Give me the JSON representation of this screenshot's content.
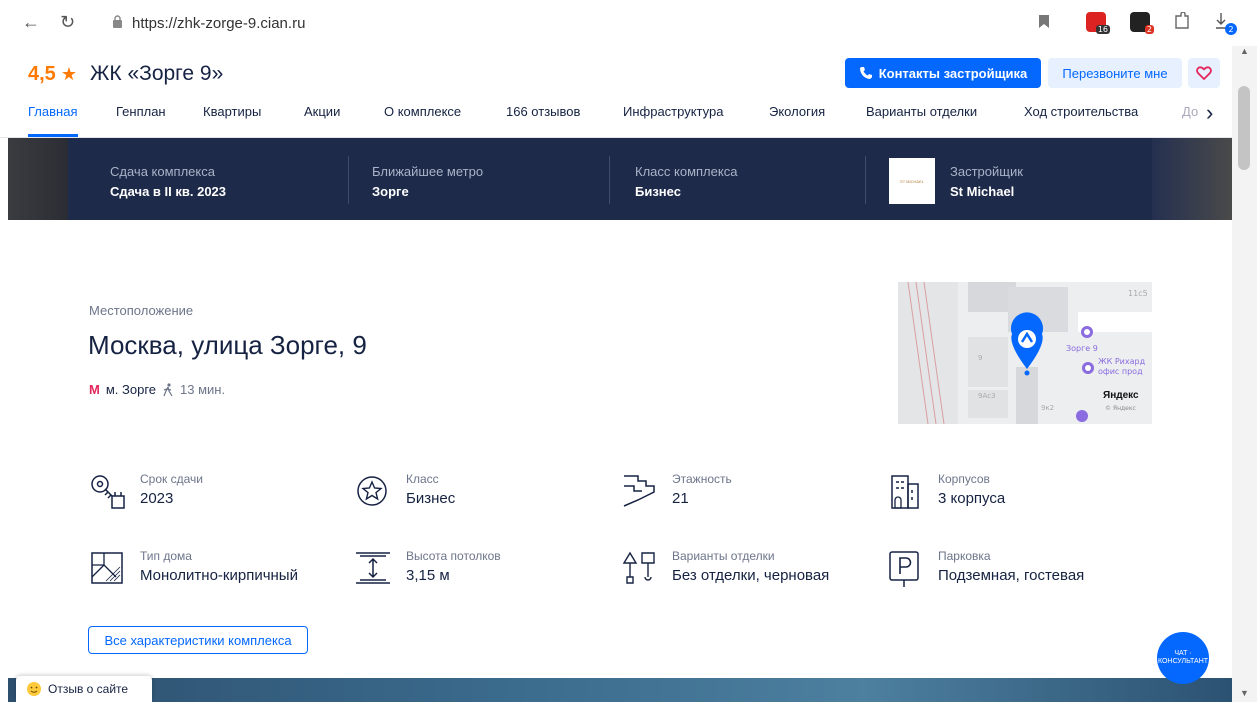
{
  "browser": {
    "url": "https://zhk-zorge-9.cian.ru",
    "ext_badges": [
      "16",
      "2"
    ],
    "download_badge": "2"
  },
  "header": {
    "rating": "4,5",
    "title": "ЖК «Зорге 9»",
    "contact_button": "Контакты застройщика",
    "callback_button": "Перезвоните мне"
  },
  "tabs": [
    {
      "label": "Главная"
    },
    {
      "label": "Генплан"
    },
    {
      "label": "Квартиры"
    },
    {
      "label": "Акции"
    },
    {
      "label": "О комплексе"
    },
    {
      "label": "166 отзывов"
    },
    {
      "label": "Инфраструктура"
    },
    {
      "label": "Экология"
    },
    {
      "label": "Варианты отделки"
    },
    {
      "label": "Ход строительства"
    },
    {
      "label": "До"
    }
  ],
  "info_band": [
    {
      "label": "Сдача комплекса",
      "value": "Сдача в II кв. 2023"
    },
    {
      "label": "Ближайшее метро",
      "value": "Зорге"
    },
    {
      "label": "Класс комплекса",
      "value": "Бизнес"
    },
    {
      "label": "Застройщик",
      "value": "St Michael",
      "logo_text": "ST MICHAEL"
    }
  ],
  "location": {
    "label": "Местоположение",
    "address": "Москва, улица Зорге, 9",
    "metro_letter": "М",
    "metro": "м. Зорге",
    "walk_time": "13 мин."
  },
  "map": {
    "labels": {
      "building": "11с5",
      "zorge": "Зорге 9",
      "rihard": "ЖК Рихард",
      "office": "офис прод",
      "yandex": "Яндекс",
      "copyright": "© Яндекс",
      "n9": "9",
      "n9a": "9Ас3",
      "n9b": "9к2"
    }
  },
  "features": [
    {
      "label": "Срок сдачи",
      "value": "2023",
      "icon": "keys-icon"
    },
    {
      "label": "Класс",
      "value": "Бизнес",
      "icon": "star-badge-icon"
    },
    {
      "label": "Этажность",
      "value": "21",
      "icon": "stairs-icon"
    },
    {
      "label": "Корпусов",
      "value": "3 корпуса",
      "icon": "buildings-icon"
    },
    {
      "label": "Тип дома",
      "value": "Монолитно-кирпичный",
      "icon": "wall-icon"
    },
    {
      "label": "Высота потолков",
      "value": "3,15 м",
      "icon": "ceiling-height-icon"
    },
    {
      "label": "Варианты отделки",
      "value": "Без отделки, черновая",
      "icon": "brush-icon"
    },
    {
      "label": "Парковка",
      "value": "Подземная, гостевая",
      "icon": "parking-icon"
    }
  ],
  "all_characteristics_button": "Все характеристики комплекса",
  "feedback_label": "Отзыв о сайте",
  "chat_label": "ЧАТ · КОНСУЛЬТАНТ",
  "colors": {
    "accent": "#0468ff",
    "rating": "#ff7a00",
    "band": "#1d2a4a",
    "metro": "#e5265c"
  }
}
